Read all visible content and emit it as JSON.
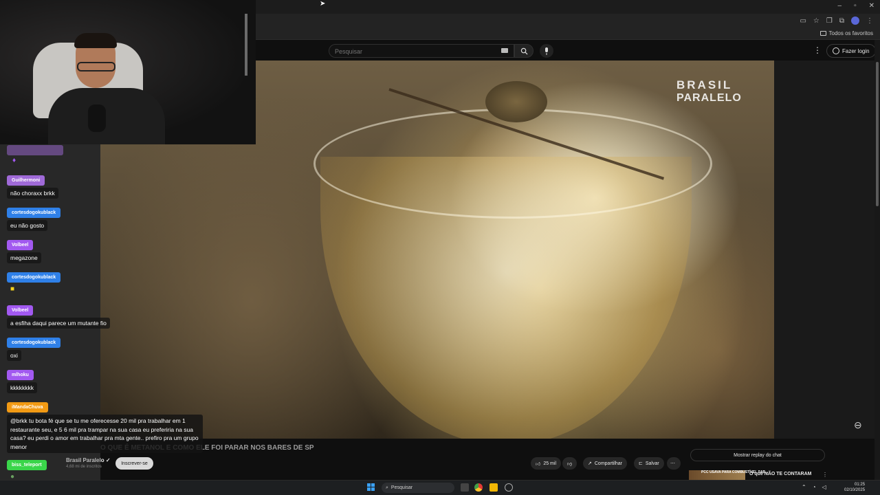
{
  "browser": {
    "window_controls": [
      "–",
      "▫",
      "✕"
    ],
    "bookmarks_folder": "Todos os favoritos"
  },
  "youtube": {
    "search_placeholder": "Pesquisar",
    "login_label": "Fazer login",
    "brand_line1": "BRASIL",
    "brand_line2": "PARALELO",
    "video_title": "O QUE É METANOL E COMO ELE FOI PARAR NOS BARES DE SP",
    "channel_name": "Brasil Paralelo",
    "channel_subs": "4,68 mi de inscritos",
    "subscribe_label": "Inscrever-se",
    "likes": "25 mil",
    "share_label": "Compartilhar",
    "save_label": "Salvar",
    "chat_replay_label": "Mostrar replay do chat",
    "recommendation_title": "O que NÃO TE CONTARAM",
    "recommendation_thumb_text": "PCC USAVA PARA COMBUSTÍVEL SAB..."
  },
  "chat": {
    "messages": [
      {
        "user": "Guilhermoni",
        "text": "não choraxx brkk",
        "color": "#a06ad8"
      },
      {
        "user": "cortesdogokublack",
        "text": "eu não gosto",
        "color": "#2f80e8"
      },
      {
        "user": "Volbeel",
        "text": "megazone",
        "color": "#a259f0"
      },
      {
        "user": "cortesdogokublack",
        "text": "",
        "color": "#2f80e8"
      },
      {
        "user": "Volbeel",
        "text": "a esfiha daqui parece um mutante fio",
        "color": "#a259f0"
      },
      {
        "user": "cortesdogokublack",
        "text": "oxi",
        "color": "#2f80e8"
      },
      {
        "user": "mlhoku",
        "text": "kkkkkkkk",
        "color": "#a259f0"
      },
      {
        "user": "iMandaChuva",
        "text": "@brkk tu bota fé que se tu me oferecesse 20 mil pra trabalhar em 1 restaurante seu, e 5 6 mil pra trampar na sua casa eu preferiria na sua casa? eu perdi o amor em trabalhar pra mta gente.. prefiro pra um grupo menor",
        "color": "#f29a14"
      },
      {
        "user": "biss_teleport",
        "text": "",
        "color": "#3ad64a"
      }
    ]
  },
  "taskbar": {
    "search_placeholder": "Pesquisar",
    "time": "01:25",
    "date": "02/10/2025"
  }
}
